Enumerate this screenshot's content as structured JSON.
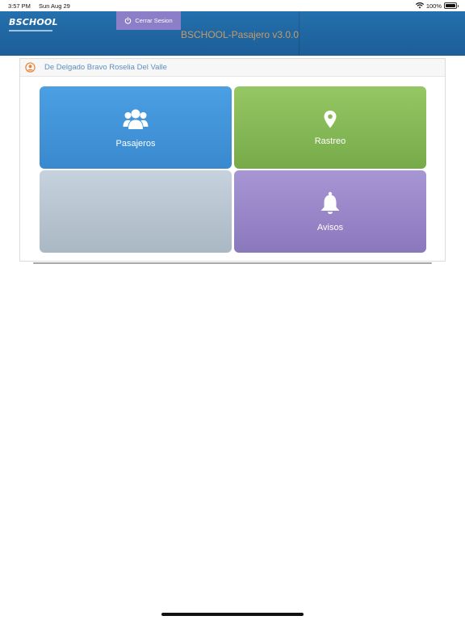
{
  "statusbar": {
    "time": "3:57 PM",
    "date": "Sun Aug 29",
    "battery": "100%",
    "battery_level_percent": 100
  },
  "header": {
    "logo": "BSCHOOL",
    "logout_label": "Cerrar Sesion",
    "app_title": "BSCHOOL-Pasajero v3.0.0"
  },
  "user": {
    "name": "De Delgado Bravo Roselia Del Valle"
  },
  "tiles": {
    "pasajeros": {
      "label": "Pasajeros",
      "icon": "users-icon",
      "color": "#4294d9"
    },
    "rastreo": {
      "label": "Rastreo",
      "icon": "location-pin-icon",
      "color": "#86b957"
    },
    "empty": {
      "label": "",
      "color": "#b8c5d0"
    },
    "avisos": {
      "label": "Avisos",
      "icon": "bell-icon",
      "color": "#9987c9"
    }
  },
  "colors": {
    "header": "#1f66a3",
    "logout_button": "#8d7fc7",
    "title": "#c99a63",
    "user_name": "#5c8fbf",
    "user_icon": "#e8843a"
  }
}
